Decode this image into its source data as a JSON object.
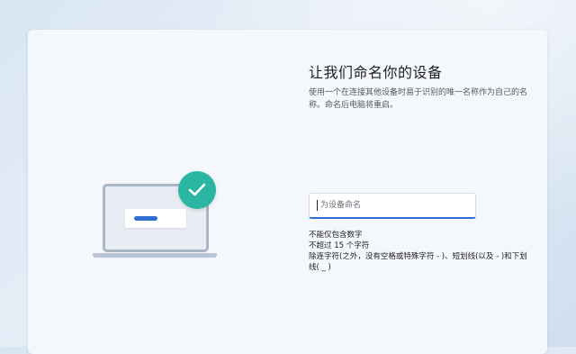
{
  "dialog": {
    "title": "让我们命名你的设备",
    "description": "使用一个在连接其他设备时易于识别的唯一名称作为自己的名称。命名后电脑将重启。",
    "name_input": {
      "value": "",
      "placeholder": "为设备命名"
    },
    "rules": [
      "不能仅包含数字",
      "不超过 15 个字符",
      "除连字符(之外，没有空格或特殊字符 - )、短划线(以及 - )和下划线( _ )"
    ]
  },
  "illustration": {
    "icons": [
      "laptop-icon",
      "checkmark-icon"
    ],
    "badge_color": "#2bb5a3",
    "accent_color": "#2f6fd1"
  }
}
